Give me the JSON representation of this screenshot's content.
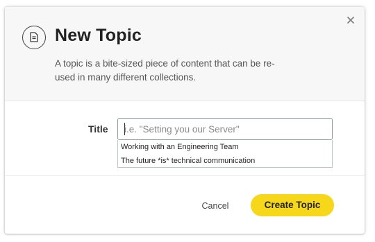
{
  "modal": {
    "title": "New Topic",
    "description": "A topic is a bite-sized piece of content that can be re-used in many different collections.",
    "close_icon": "close-icon",
    "title_icon": "document-icon"
  },
  "form": {
    "title_label": "Title",
    "title_value": "",
    "title_placeholder": "i.e. \"Setting you our Server\"",
    "suggestions": [
      "Working with an Engineering Team",
      "The future *is* technical communication"
    ]
  },
  "actions": {
    "cancel_label": "Cancel",
    "create_label": "Create Topic"
  },
  "colors": {
    "accent": "#f6d71a",
    "header_bg": "#f7f7f7"
  }
}
